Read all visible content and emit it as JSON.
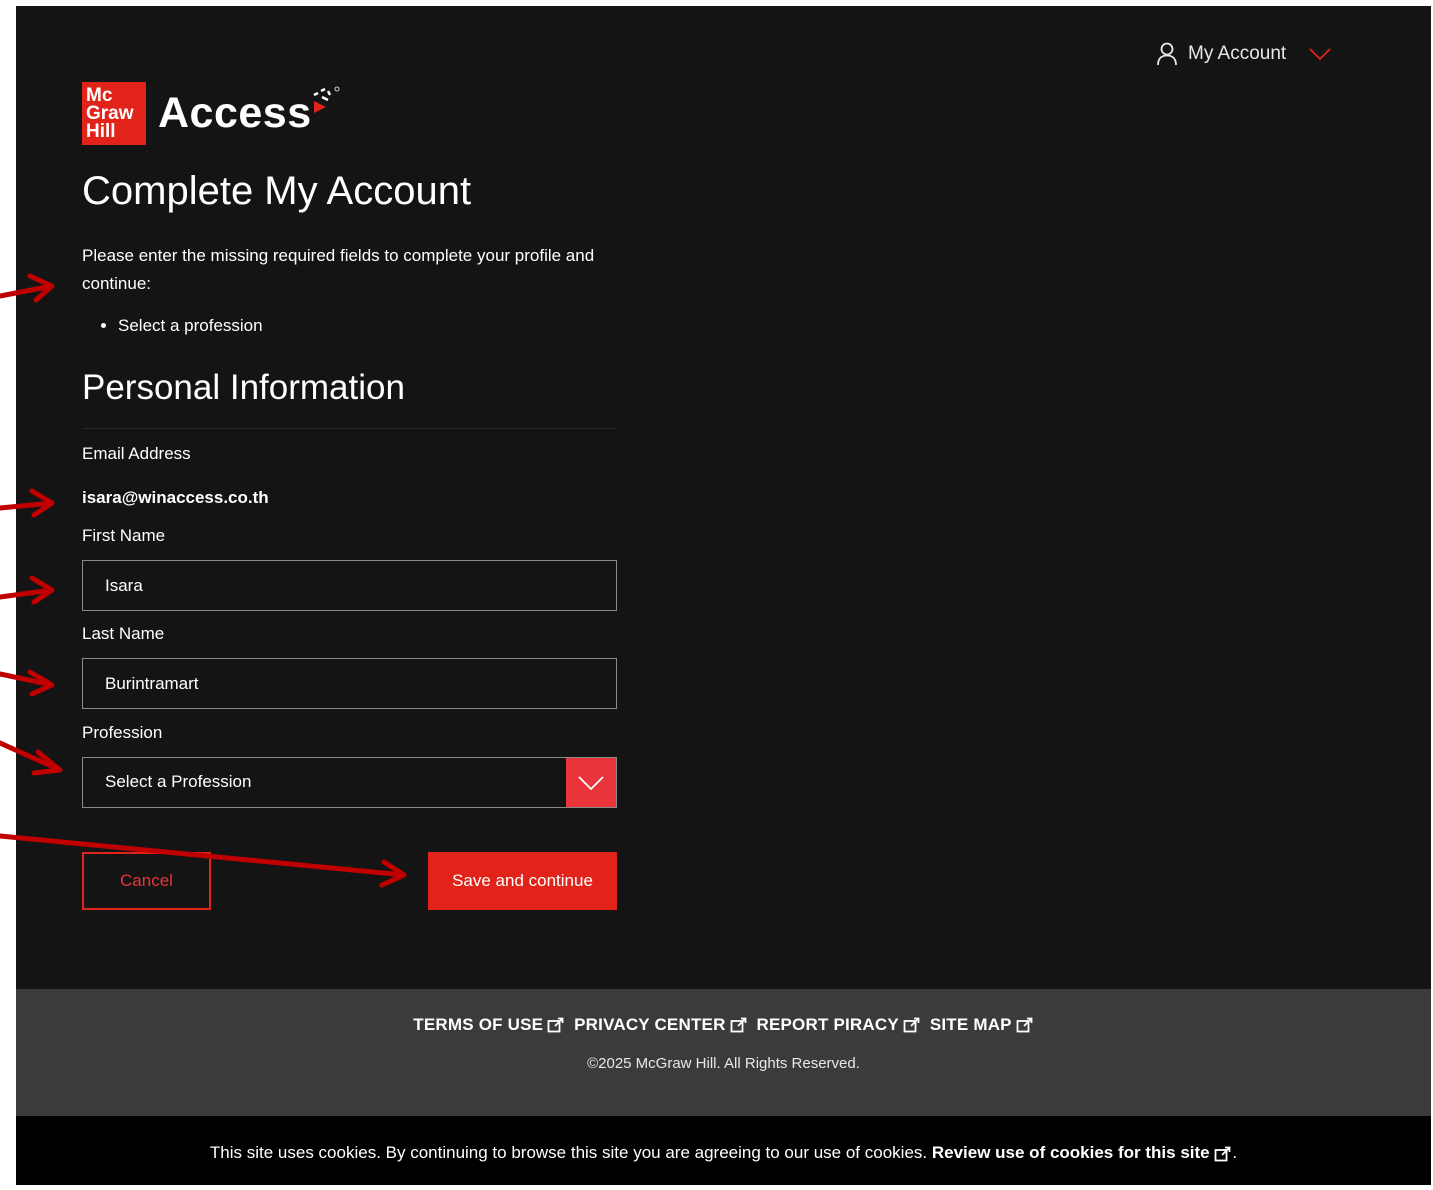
{
  "header": {
    "account_label": "My Account"
  },
  "logo": {
    "box_lines": [
      "Mc",
      "Graw",
      "Hill"
    ],
    "word": "Access"
  },
  "page": {
    "title": "Complete My Account",
    "intro": "Please enter the missing required fields to complete your profile and continue:",
    "required_items": [
      "Select a profession"
    ]
  },
  "personal_info": {
    "title": "Personal Information",
    "email_label": "Email Address",
    "email_value": "isara@winaccess.co.th",
    "first_name_label": "First Name",
    "first_name_value": "Isara",
    "last_name_label": "Last Name",
    "last_name_value": "Burintramart",
    "profession_label": "Profession",
    "profession_selected": "Select a Profession"
  },
  "actions": {
    "cancel_label": "Cancel",
    "save_label": "Save and continue"
  },
  "footer": {
    "links": [
      "TERMS OF USE",
      "PRIVACY CENTER",
      "REPORT PIRACY",
      "SITE MAP"
    ],
    "copyright": "©2025 McGraw Hill. All Rights Reserved."
  },
  "cookie": {
    "text": "This site uses cookies. By continuing to browse this site you are agreeing to our use of cookies.",
    "link_label": "Review use of cookies for this site",
    "suffix": "."
  },
  "colors": {
    "brand_red": "#e2231a",
    "background": "#141414",
    "footer_bg": "#3b3b3b",
    "annotation_arrow": "#c00000"
  }
}
